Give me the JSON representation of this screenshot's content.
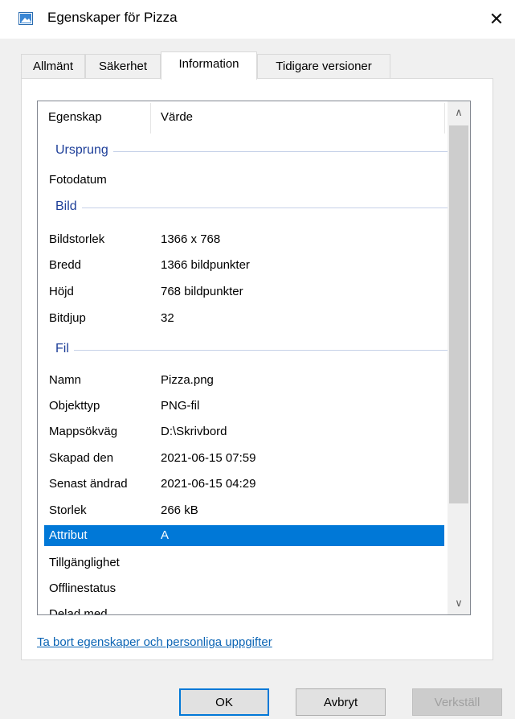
{
  "window": {
    "title": "Egenskaper för Pizza",
    "close_glyph": "✕",
    "icon": "image-file-icon"
  },
  "tabs": [
    {
      "label": "Allmänt"
    },
    {
      "label": "Säkerhet"
    },
    {
      "label": "Information",
      "active": true
    },
    {
      "label": "Tidigare versioner"
    }
  ],
  "list": {
    "header": {
      "property": "Egenskap",
      "value": "Värde"
    },
    "groups": {
      "origin": "Ursprung",
      "image": "Bild",
      "file": "Fil"
    },
    "rows": {
      "photo_date": {
        "key": "Fotodatum",
        "value": ""
      },
      "dimensions": {
        "key": "Bildstorlek",
        "value": "1366 x 768"
      },
      "width": {
        "key": "Bredd",
        "value": "1366 bildpunkter"
      },
      "height": {
        "key": "Höjd",
        "value": "768 bildpunkter"
      },
      "bit_depth": {
        "key": "Bitdjup",
        "value": "32"
      },
      "name": {
        "key": "Namn",
        "value": "Pizza.png"
      },
      "item_type": {
        "key": "Objekttyp",
        "value": "PNG-fil"
      },
      "folder_path": {
        "key": "Mappsökväg",
        "value": "D:\\Skrivbord"
      },
      "created": {
        "key": "Skapad den",
        "value": "2021-06-15 07:59"
      },
      "modified": {
        "key": "Senast ändrad",
        "value": "2021-06-15 04:29"
      },
      "size": {
        "key": "Storlek",
        "value": "266 kB"
      },
      "attributes": {
        "key": "Attribut",
        "value": "A",
        "selected": true
      },
      "availability": {
        "key": "Tillgänglighet",
        "value": ""
      },
      "offline": {
        "key": "Offlinestatus",
        "value": ""
      },
      "shared_with": {
        "key": "Delad med",
        "value": ""
      }
    },
    "scroll_up_glyph": "∧",
    "scroll_down_glyph": "∨"
  },
  "remove_link": "Ta bort egenskaper och personliga uppgifter",
  "buttons": {
    "ok": "OK",
    "cancel": "Avbryt",
    "apply": "Verkställ"
  },
  "colors": {
    "accent": "#0078d7",
    "group_text": "#1e3f99",
    "link": "#0a64b4"
  }
}
